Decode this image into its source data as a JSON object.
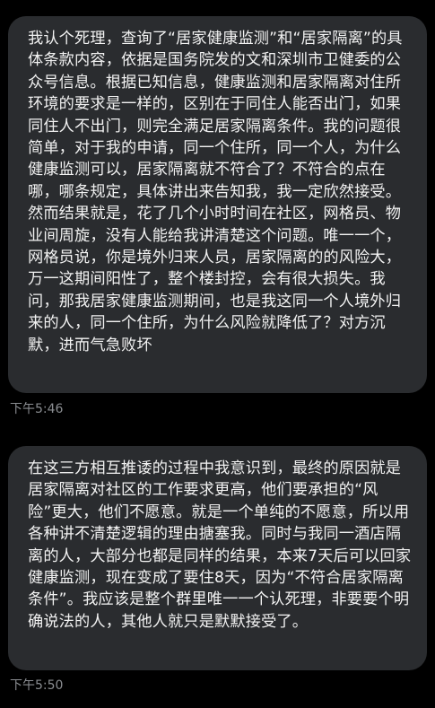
{
  "messages": [
    {
      "text": "我认个死理，查询了“居家健康监测”和“居家隔离”的具体条款内容，依据是国务院发的文和深圳市卫健委的公众号信息。根据已知信息，健康监测和居家隔离对住所环境的要求是一样的，区别在于同住人能否出门，如果同住人不出门，则完全满足居家隔离条件。我的问题很简单，对于我的申请，同一个住所，同一个人，为什么健康监测可以，居家隔离就不符合了？不符合的点在哪，哪条规定，具体讲出来告知我，我一定欣然接受。然而结果就是，花了几个小时时间在社区，网格员、物业间周旋，没有人能给我讲清楚这个问题。唯一一个，网格员说，你是境外归来人员，居家隔离的的风险大，万一这期间阳性了，整个楼封控，会有很大损失。我问，那我居家健康监测期间，也是我这同一个人境外归来的人，同一个住所，为什么风险就降低了？对方沉默，进而气急败坏",
      "time": "下午5:46"
    },
    {
      "text": "在这三方相互推诿的过程中我意识到，最终的原因就是居家隔离对社区的工作要求更高，他们要承担的“风险”更大，他们不愿意。就是一个单纯的不愿意，所以用各种讲不清楚逻辑的理由搪塞我。同时与我同一酒店隔离的人，大部分也都是同样的结果，本来7天后可以回家健康监测，现在变成了要住8天，因为“不符合居家隔离条件”。我应该是整个群里唯一一个认死理，非要要个明确说法的人，其他人就只是默默接受了。",
      "time": "下午5:50"
    }
  ]
}
